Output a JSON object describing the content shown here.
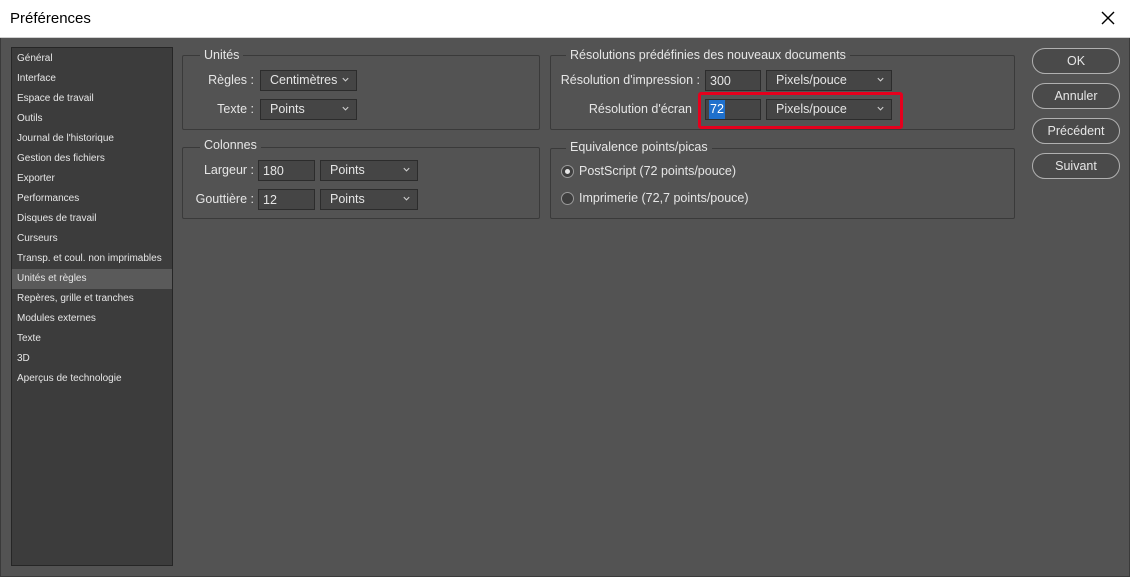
{
  "window": {
    "title": "Préférences"
  },
  "sidebar": {
    "active_index": 11,
    "items": [
      "Général",
      "Interface",
      "Espace de travail",
      "Outils",
      "Journal de l'historique",
      "Gestion des fichiers",
      "Exporter",
      "Performances",
      "Disques de travail",
      "Curseurs",
      "Transp. et coul. non imprimables",
      "Unités et règles",
      "Repères, grille et tranches",
      "Modules externes",
      "Texte",
      "3D",
      "Aperçus de technologie"
    ]
  },
  "units": {
    "title": "Unités",
    "rulers_label": "Règles :",
    "rulers_value": "Centimètres",
    "type_label": "Texte :",
    "type_value": "Points"
  },
  "columns": {
    "title": "Colonnes",
    "width_label": "Largeur :",
    "width_value": "180",
    "width_unit": "Points",
    "gutter_label": "Gouttière :",
    "gutter_value": "12",
    "gutter_unit": "Points"
  },
  "resolutions": {
    "title": "Résolutions prédéfinies des nouveaux documents",
    "print_label": "Résolution d'impression :",
    "print_value": "300",
    "print_unit": "Pixels/pouce",
    "screen_label": "Résolution d'écran",
    "screen_value": "72",
    "screen_unit": "Pixels/pouce"
  },
  "point_size": {
    "title": "Equivalence points/picas",
    "options": [
      "PostScript (72 points/pouce)",
      "Imprimerie (72,7 points/pouce)"
    ],
    "selected_index": 0
  },
  "buttons": {
    "ok": "OK",
    "cancel": "Annuler",
    "prev": "Précédent",
    "next": "Suivant"
  },
  "colors": {
    "panel_bg": "#535353",
    "sidebar_bg": "#3c3c3c",
    "selection_blue": "#1f70cc",
    "highlight_red": "#e5001d"
  }
}
